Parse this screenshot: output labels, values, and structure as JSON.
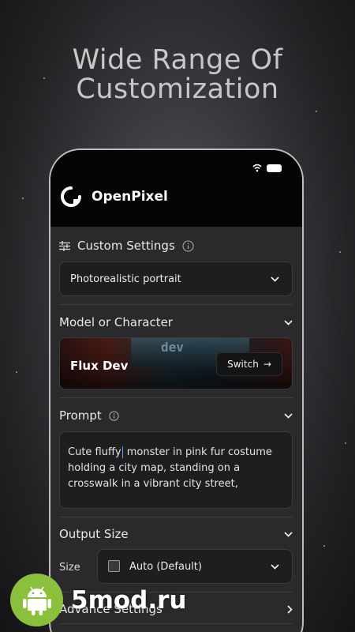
{
  "headline": {
    "line1": "Wide Range Of",
    "line2": "Customization"
  },
  "app": {
    "name": "OpenPixel"
  },
  "custom_settings": {
    "title": "Custom Settings",
    "selected_preset": "Photorealistic portrait"
  },
  "model": {
    "section_title": "Model or Character",
    "name": "Flux Dev",
    "banner_text": "dev",
    "switch_label": "Switch",
    "switch_arrow": "→"
  },
  "prompt": {
    "title": "Prompt",
    "text_before_cursor": "Cute fluffy",
    "text_after_cursor": " monster in pink fur costume holding a city map, standing on a crosswalk in a vibrant city street,"
  },
  "output_size": {
    "title": "Output Size",
    "size_label": "Size",
    "size_value": "Auto (Default)"
  },
  "advance_settings": {
    "title": "Advance Settings"
  },
  "watermark": {
    "text": "5mod.ru"
  },
  "colors": {
    "accent_brand": "#ffffff",
    "watermark_green": "#8bc03c",
    "cursor_blue": "#5aa0ff"
  }
}
